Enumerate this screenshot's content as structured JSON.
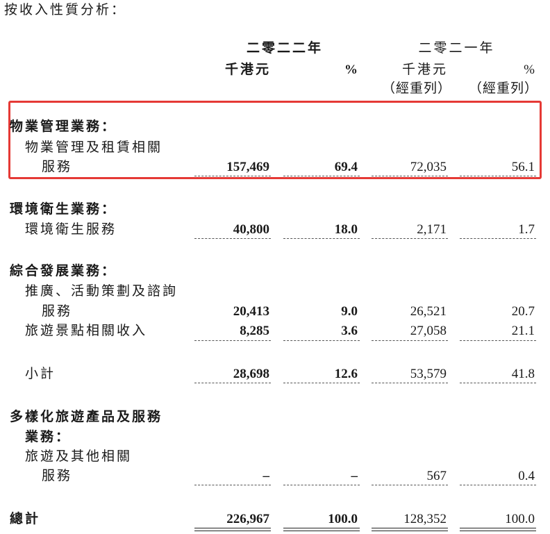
{
  "title": "按收入性質分析：",
  "header": {
    "year_2022": "二零二二年",
    "year_2021": "二零二一年",
    "unit_hkd": "千港元",
    "unit_pct": "%",
    "restated": "（經重列）"
  },
  "sections": {
    "property": {
      "heading": "物業管理業務：",
      "item_line1": "物業管理及租賃相關",
      "item_line2": "服務",
      "values": [
        "157,469",
        "69.4",
        "72,035",
        "56.1"
      ]
    },
    "environment": {
      "heading": "環境衛生業務：",
      "item": "環境衛生服務",
      "values": [
        "40,800",
        "18.0",
        "2,171",
        "1.7"
      ]
    },
    "development": {
      "heading": "綜合發展業務：",
      "item1_line1": "推廣、活動策劃及諮詢",
      "item1_line2": "服務",
      "item1_values": [
        "20,413",
        "9.0",
        "26,521",
        "20.7"
      ],
      "item2": "旅遊景點相關收入",
      "item2_values": [
        "8,285",
        "3.6",
        "27,058",
        "21.1"
      ],
      "subtotal_label": "小計",
      "subtotal_values": [
        "28,698",
        "12.6",
        "53,579",
        "41.8"
      ]
    },
    "tourism": {
      "heading_line1": "多樣化旅遊產品及服務",
      "heading_line2": "業務：",
      "item_line1": "旅遊及其他相關",
      "item_line2": "服務",
      "values": [
        "–",
        "–",
        "567",
        "0.4"
      ]
    },
    "total": {
      "label": "總計",
      "values": [
        "226,967",
        "100.0",
        "128,352",
        "100.0"
      ]
    }
  },
  "colors": {
    "highlight": "#e53935"
  }
}
